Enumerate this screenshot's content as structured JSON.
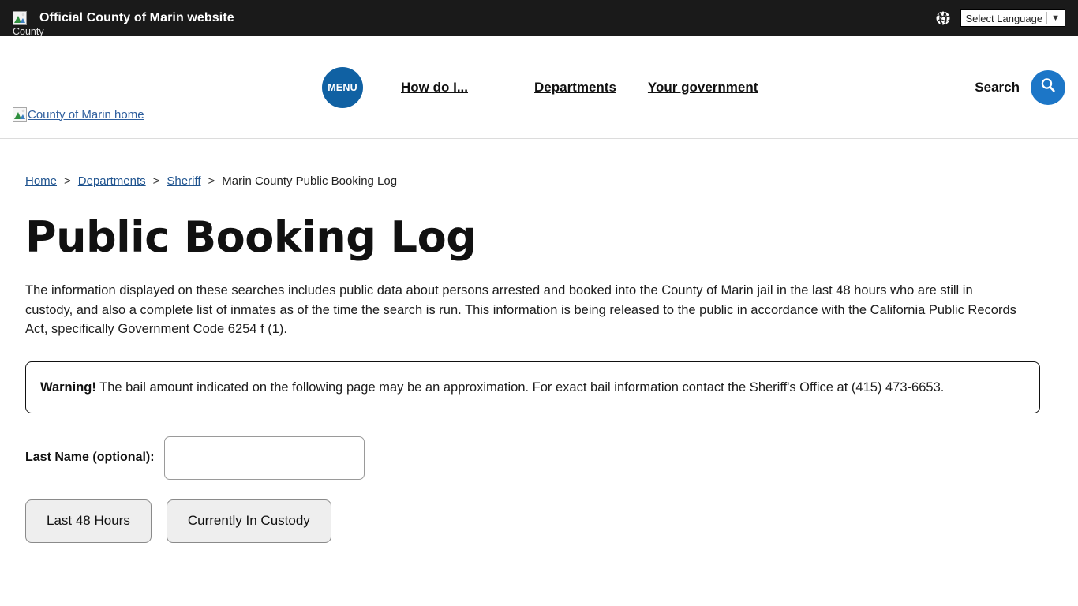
{
  "topbar": {
    "icon": "broken-image-icon",
    "icon_alt": "County",
    "title": "Official County of Marin website",
    "globe_icon": "globe-icon",
    "language_selected": "Select Language",
    "language_caret": "▼"
  },
  "header": {
    "logo_icon": "broken-image-icon",
    "logo_text": "County of Marin home",
    "menu_label": "MENU",
    "nav": [
      {
        "label": "How do I..."
      },
      {
        "label": "Departments"
      },
      {
        "label": "Your government"
      }
    ],
    "search_label": "Search",
    "search_icon": "search-icon"
  },
  "breadcrumb": {
    "items": [
      {
        "label": "Home",
        "link": true
      },
      {
        "label": "Departments",
        "link": true
      },
      {
        "label": "Sheriff",
        "link": true
      },
      {
        "label": "Marin County Public Booking Log",
        "link": false
      }
    ],
    "separator": ">"
  },
  "main": {
    "title": "Public Booking Log",
    "intro": "The information displayed on these searches includes public data about persons arrested and booked into the County of Marin jail in the last 48 hours who are still in custody, and also a complete list of inmates as of the time the search is run. This information is being released to the public in accordance with the California Public Records Act, specifically Government Code 6254 f (1).",
    "warning_label": "Warning!",
    "warning_text": " The bail amount indicated on the following page may be an approximation. For exact bail information contact the Sheriff's Office at (415) 473-6653.",
    "form": {
      "last_name_label": "Last Name (optional):",
      "last_name_value": "",
      "last_name_placeholder": ""
    },
    "buttons": [
      {
        "label": "Last 48 Hours"
      },
      {
        "label": "Currently In Custody"
      }
    ]
  },
  "colors": {
    "topbar_bg": "#1a1a1a",
    "menu_blue": "#1061a3",
    "search_blue": "#1c76c7",
    "link_blue": "#20548f"
  }
}
